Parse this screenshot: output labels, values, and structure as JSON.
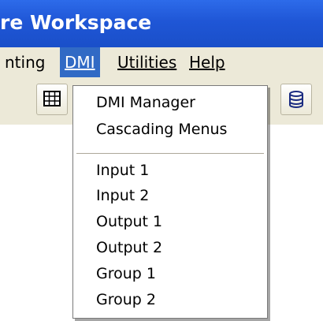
{
  "window": {
    "title": "re Workspace"
  },
  "menubar": {
    "items": [
      {
        "label": "nting"
      },
      {
        "label": "DMI",
        "active": true
      },
      {
        "label": "Utilities"
      },
      {
        "label": "Help"
      }
    ]
  },
  "toolbar": {
    "buttons": [
      {
        "icon": "grid-icon"
      },
      {
        "icon": "database-icon"
      }
    ]
  },
  "dmi_menu": {
    "items": [
      "DMI Manager",
      "Cascading Menus"
    ],
    "items2": [
      "Input 1",
      "Input 2",
      "Output 1",
      "Output 2",
      "Group 1",
      "Group 2"
    ]
  },
  "colors": {
    "title_bar": "#1f56d6",
    "menu_highlight": "#316ac5",
    "menu_bg": "#ece9d8"
  }
}
